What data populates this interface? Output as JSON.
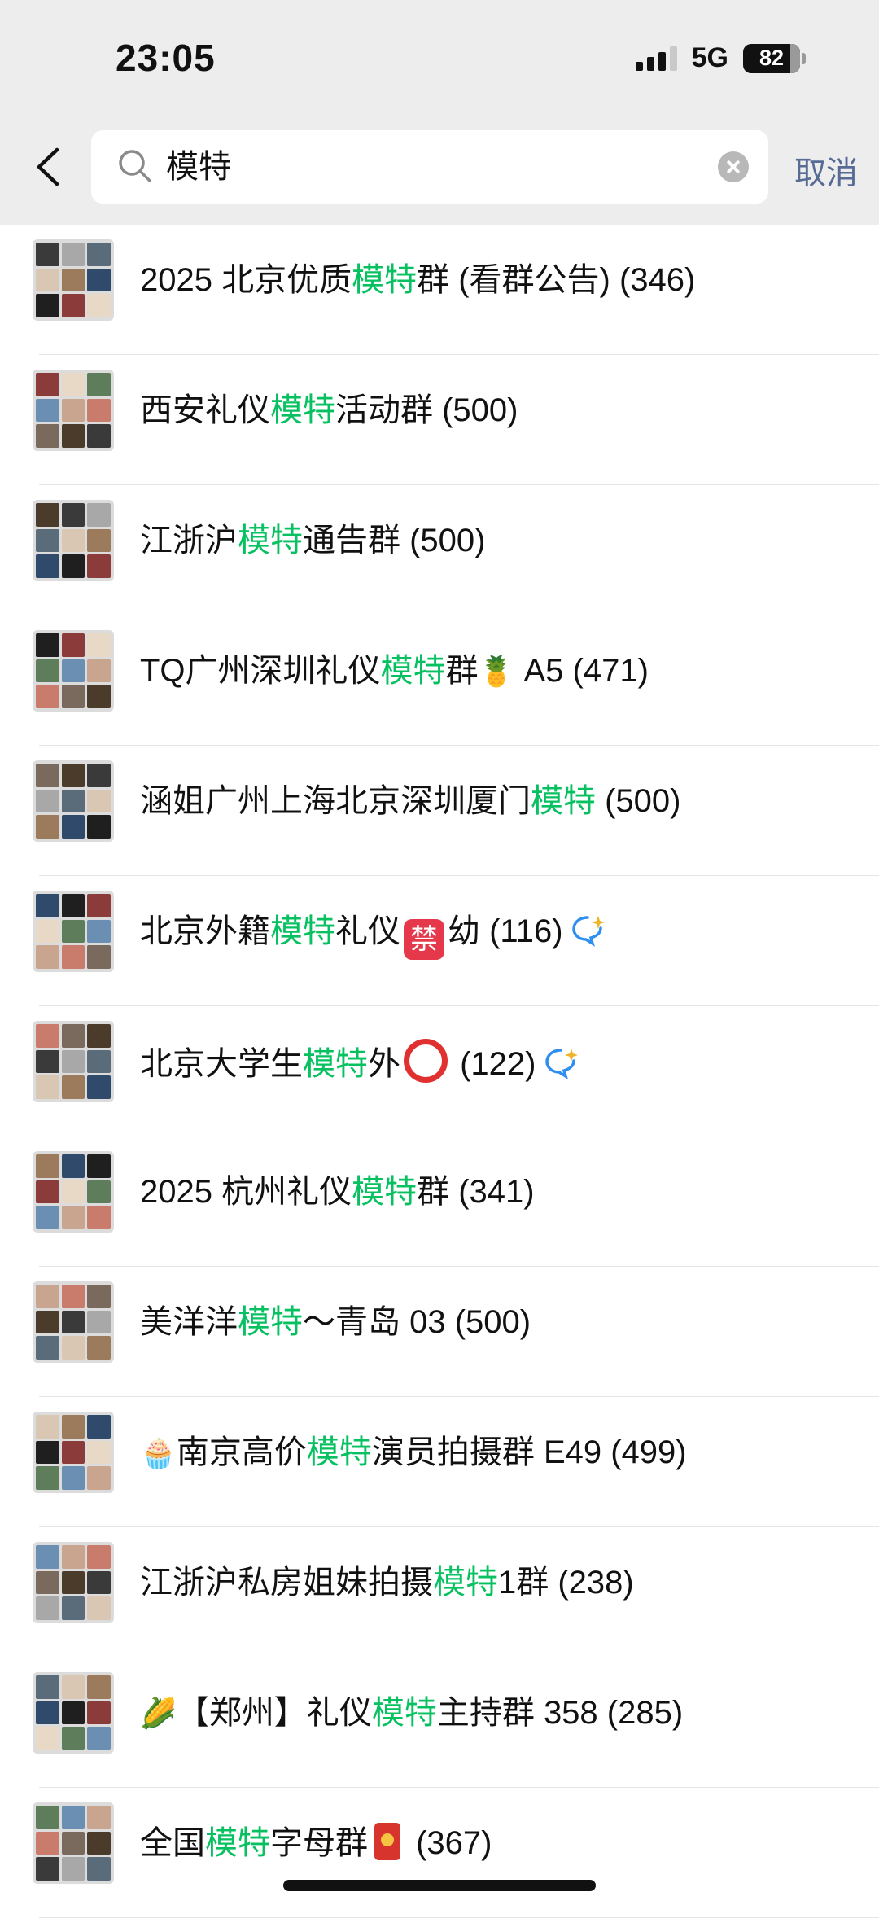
{
  "status_bar": {
    "time": "23:05",
    "network": "5G",
    "battery": "82"
  },
  "search": {
    "query": "模特",
    "cancel_label": "取消"
  },
  "results": [
    {
      "pre": "2025 北京优质",
      "hl": "模特",
      "post": "群 (看群公告) (346)"
    },
    {
      "pre": "西安礼仪",
      "hl": "模特",
      "post": "活动群 (500)"
    },
    {
      "pre": "江浙沪",
      "hl": "模特",
      "post": "通告群 (500)"
    },
    {
      "pre": "TQ广州深圳礼仪",
      "hl": "模特",
      "post": "群",
      "emoji_after": "🍍",
      "post2": " A5 (471)"
    },
    {
      "pre": "涵姐广州上海北京深圳厦门",
      "hl": "模特",
      "post": " (500)"
    },
    {
      "pre": "北京外籍",
      "hl": "模特",
      "post": "礼仪",
      "ban_label": "禁",
      "post2": "幼 (116)",
      "mark": "chat-ai-icon"
    },
    {
      "pre": "北京大学生",
      "hl": "模特",
      "post": "外",
      "post2": " (122)",
      "mark": "chat-ai-icon"
    },
    {
      "pre": "2025 杭州礼仪",
      "hl": "模特",
      "post": "群 (341)"
    },
    {
      "pre": "美洋洋",
      "hl": "模特",
      "post": "～青岛 03 (500)"
    },
    {
      "emoji_before": "🧁",
      "pre": "南京高价",
      "hl": "模特",
      "post": "演员拍摄群 E49 (499)"
    },
    {
      "pre": "江浙沪私房姐妹拍摄",
      "hl": "模特",
      "post": "1群 (238)"
    },
    {
      "emoji_before": "🌽",
      "pre": "【郑州】礼仪",
      "hl": "模特",
      "post": "主持群 358 (285)"
    },
    {
      "pre": "全国",
      "hl": "模特",
      "post": "字母群",
      "post2": " (367)"
    }
  ],
  "avatar_palette": [
    "#3a3a3a",
    "#7a6a5e",
    "#c9a58f",
    "#5e7d5a",
    "#8c3b3b",
    "#2f4a6b",
    "#d9c7b4",
    "#a8a8a8",
    "#4b3b2b",
    "#c97c6b",
    "#6b8fb3",
    "#e8d9c6",
    "#1f1f1f",
    "#9b7b5b",
    "#5a6b7a"
  ]
}
